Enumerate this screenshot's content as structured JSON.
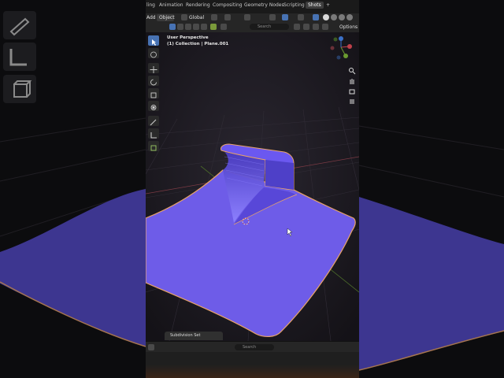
{
  "tabs": [
    "ling",
    "Animation",
    "Rendering",
    "Compositing",
    "Geometry Nodes",
    "Scripting",
    "Shots",
    "+"
  ],
  "active_tab": "Shots",
  "header": {
    "menu_add": "Add",
    "menu_object": "Object",
    "orientation": "Global",
    "options": "Options",
    "search_placeholder": "Search"
  },
  "viewport": {
    "view_name": "User Perspective",
    "collection_info": "(1) Collection | Plane.001"
  },
  "last_operator": "Subdivision Set",
  "footer": {
    "search_placeholder": "Search"
  },
  "colors": {
    "mesh": "#6e5ce8",
    "selection": "#e9a36a",
    "accent": "#4772b3"
  },
  "icons": [
    "cursor-icon",
    "move-icon",
    "rotate-icon",
    "scale-icon",
    "transform-icon",
    "annotate-icon",
    "measure-icon",
    "add-cube-icon",
    "hand-icon",
    "zoom-icon",
    "camera-icon",
    "grid-icon"
  ]
}
